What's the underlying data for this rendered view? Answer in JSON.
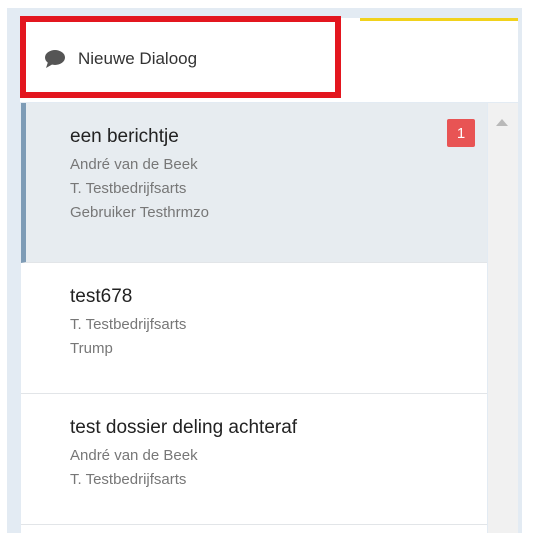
{
  "header": {
    "new_dialog_label": "Nieuwe Dialoog",
    "icon": "chat-bubble-icon"
  },
  "conversations": [
    {
      "title": "een berichtje",
      "participants": [
        "André van de Beek",
        "T. Testbedrijfsarts",
        "Gebruiker Testhrmzo"
      ],
      "unread": "1",
      "selected": true
    },
    {
      "title": "test678",
      "participants": [
        "T. Testbedrijfsarts",
        "Trump"
      ]
    },
    {
      "title": "test dossier deling achteraf",
      "participants": [
        "André van de Beek",
        "T. Testbedrijfsarts"
      ]
    }
  ],
  "colors": {
    "highlight": "#e3161f",
    "badge": "#e85454",
    "selected_border": "#7e9cb6",
    "accent": "#f1d21c"
  }
}
